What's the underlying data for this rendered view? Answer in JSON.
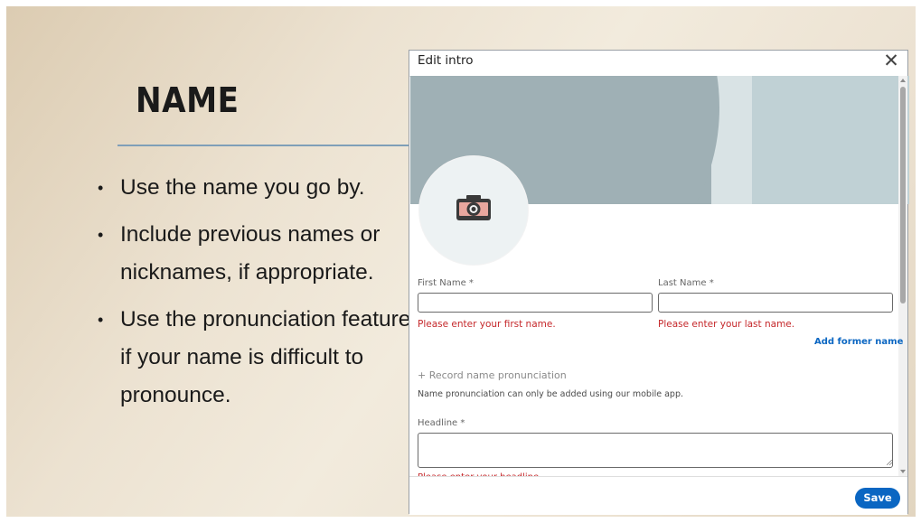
{
  "slide": {
    "title": "NAME",
    "bullets": [
      "Use the name you go by.",
      "Include previous names or nicknames, if appropriate.",
      "Use the pronunciation feature if your name is difficult to pronounce."
    ],
    "bullet_glyph": "•"
  },
  "dialog": {
    "title": "Edit intro",
    "close_glyph": "✕",
    "first_name": {
      "label": "First Name *",
      "value": "",
      "error": "Please enter your first name."
    },
    "last_name": {
      "label": "Last Name *",
      "value": "",
      "error": "Please enter your last name."
    },
    "add_former_name": "Add former name",
    "record_pronunciation": "+ Record name pronunciation",
    "pronunciation_note": "Name pronunciation can only be added using our mobile app.",
    "headline": {
      "label": "Headline *",
      "value": "",
      "error": "Please enter your headline."
    },
    "save_label": "Save"
  },
  "colors": {
    "accent": "#0a66c2",
    "error": "#c5282b",
    "banner": "#9fb0b5"
  },
  "icons": [
    "camera-icon",
    "close-icon",
    "scroll-up-icon",
    "scroll-down-icon",
    "resize-grip-icon"
  ]
}
